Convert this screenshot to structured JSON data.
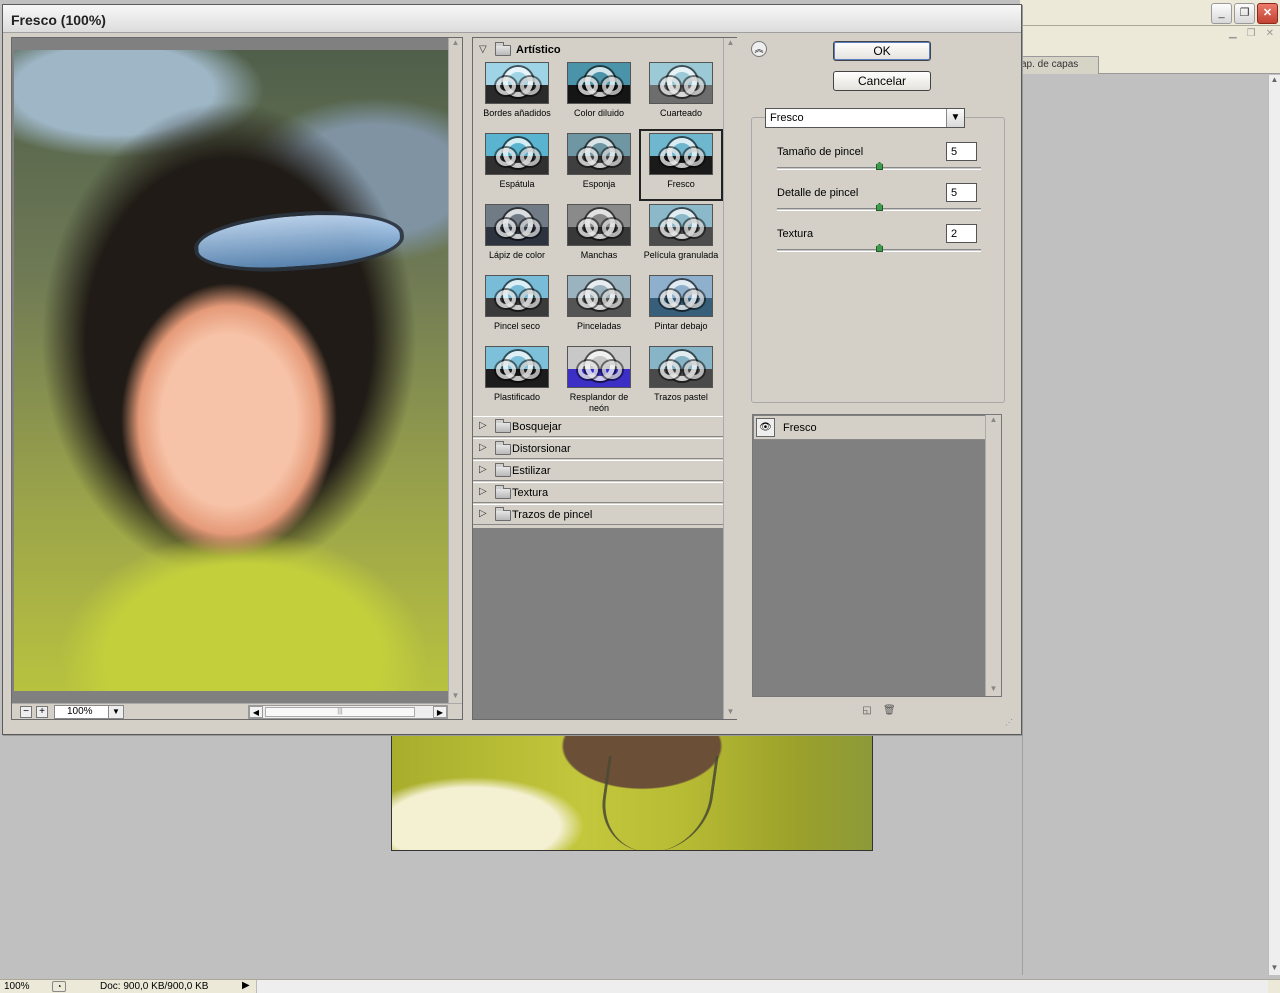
{
  "dialog": {
    "title": "Fresco (100%)",
    "ok_label": "OK",
    "cancel_label": "Cancelar",
    "collapse_icon": "double-chevron-up-icon"
  },
  "preview": {
    "zoom_out": "−",
    "zoom_in": "+",
    "zoom_value": "100%"
  },
  "gallery": {
    "open_category": "Artístico",
    "filters": [
      {
        "name": "Bordes añadidos",
        "colors": [
          "#9fd3e6",
          "#2a2a2a"
        ]
      },
      {
        "name": "Color diluido",
        "colors": [
          "#4a93a9",
          "#151515"
        ]
      },
      {
        "name": "Cuarteado",
        "colors": [
          "#9cc9d6",
          "#6d6d6d"
        ]
      },
      {
        "name": "Espátula",
        "colors": [
          "#5ab4cf",
          "#303030"
        ]
      },
      {
        "name": "Esponja",
        "colors": [
          "#6f97a3",
          "#3f3f3f"
        ]
      },
      {
        "name": "Fresco",
        "colors": [
          "#6fb7cf",
          "#1a1a1a"
        ]
      },
      {
        "name": "Lápiz de color",
        "colors": [
          "#707b86",
          "#2d3440"
        ]
      },
      {
        "name": "Manchas",
        "colors": [
          "#8a8a8a",
          "#383838"
        ]
      },
      {
        "name": "Película granulada",
        "colors": [
          "#8bb9c9",
          "#4c4c4c"
        ]
      },
      {
        "name": "Pincel seco",
        "colors": [
          "#79bcd8",
          "#3a3a3a"
        ]
      },
      {
        "name": "Pinceladas",
        "colors": [
          "#9bb3bf",
          "#545454"
        ]
      },
      {
        "name": "Pintar debajo",
        "colors": [
          "#8fb0cc",
          "#385f7a"
        ]
      },
      {
        "name": "Plastificado",
        "colors": [
          "#7cc0d9",
          "#1c1c1c"
        ]
      },
      {
        "name": "Resplandor de neón",
        "colors": [
          "#c8c8c8",
          "#3b2fc6"
        ]
      },
      {
        "name": "Trazos pastel",
        "colors": [
          "#87b4c7",
          "#4a4a4a"
        ]
      }
    ],
    "selected_filter": "Fresco",
    "categories": [
      "Bosquejar",
      "Distorsionar",
      "Estilizar",
      "Textura",
      "Trazos de pincel"
    ]
  },
  "settings": {
    "filter_selected": "Fresco",
    "params": [
      {
        "label": "Tamaño de pincel",
        "value": "5",
        "min": 0,
        "max": 10
      },
      {
        "label": "Detalle de pincel",
        "value": "5",
        "min": 0,
        "max": 10
      },
      {
        "label": "Textura",
        "value": "2",
        "min": 1,
        "max": 3
      }
    ]
  },
  "layers": {
    "items": [
      {
        "name": "Fresco"
      }
    ],
    "new_layer_icon": "new-effect-layer-icon",
    "delete_icon": "trash-icon"
  },
  "background": {
    "panel_tab": "ap. de capas",
    "status_zoom": "100%",
    "status_doc": "Doc: 900,0 KB/900,0 KB"
  }
}
